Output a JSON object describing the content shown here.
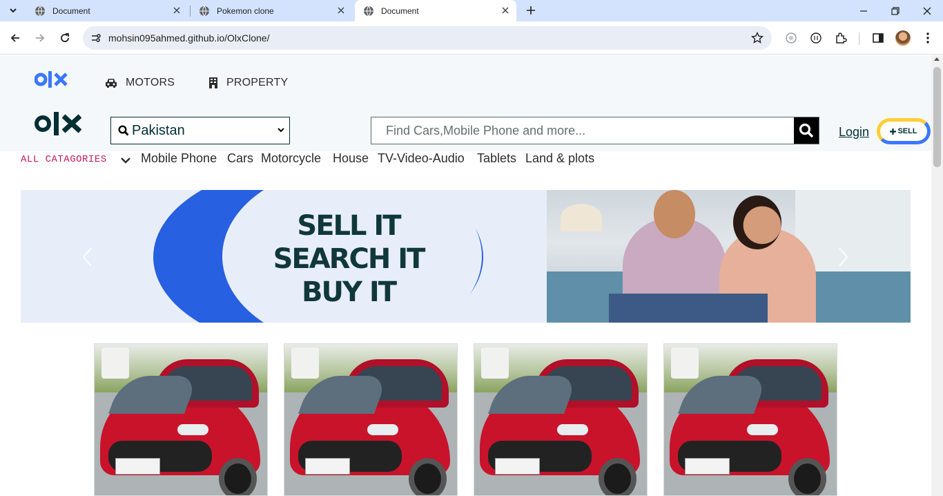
{
  "browser": {
    "tabs": [
      {
        "title": "Document",
        "active": false
      },
      {
        "title": "Pokemon clone",
        "active": false
      },
      {
        "title": "Document",
        "active": true
      }
    ],
    "url": "mohsin095ahmed.github.io/OlxClone/"
  },
  "header": {
    "nav": [
      {
        "label": "MOTORS",
        "icon": "car-icon"
      },
      {
        "label": "PROPERTY",
        "icon": "building-icon"
      }
    ],
    "location_select": {
      "value": "Pakistan"
    },
    "search": {
      "placeholder": "Find Cars,Mobile Phone and more..."
    },
    "login_label": "Login",
    "sell_label": "SELL"
  },
  "categories": {
    "all_label": "ALL CATAGORIES",
    "items": [
      "Mobile Phone",
      "Cars",
      "Motorcycle",
      "House",
      "TV-Video-Audio",
      "Tablets",
      "Land & plots"
    ]
  },
  "banner": {
    "lines": [
      "SELL IT",
      "SEARCH IT",
      "BUY IT"
    ]
  },
  "products": {
    "count": 4,
    "image": "red-hatchback-car"
  },
  "colors": {
    "brand_dark": "#002f34",
    "category_accent": "#c2185b",
    "banner_blue": "#2760e0",
    "header_bg": "#f5f8fb",
    "browser_tabbar": "#d3e3fd"
  }
}
